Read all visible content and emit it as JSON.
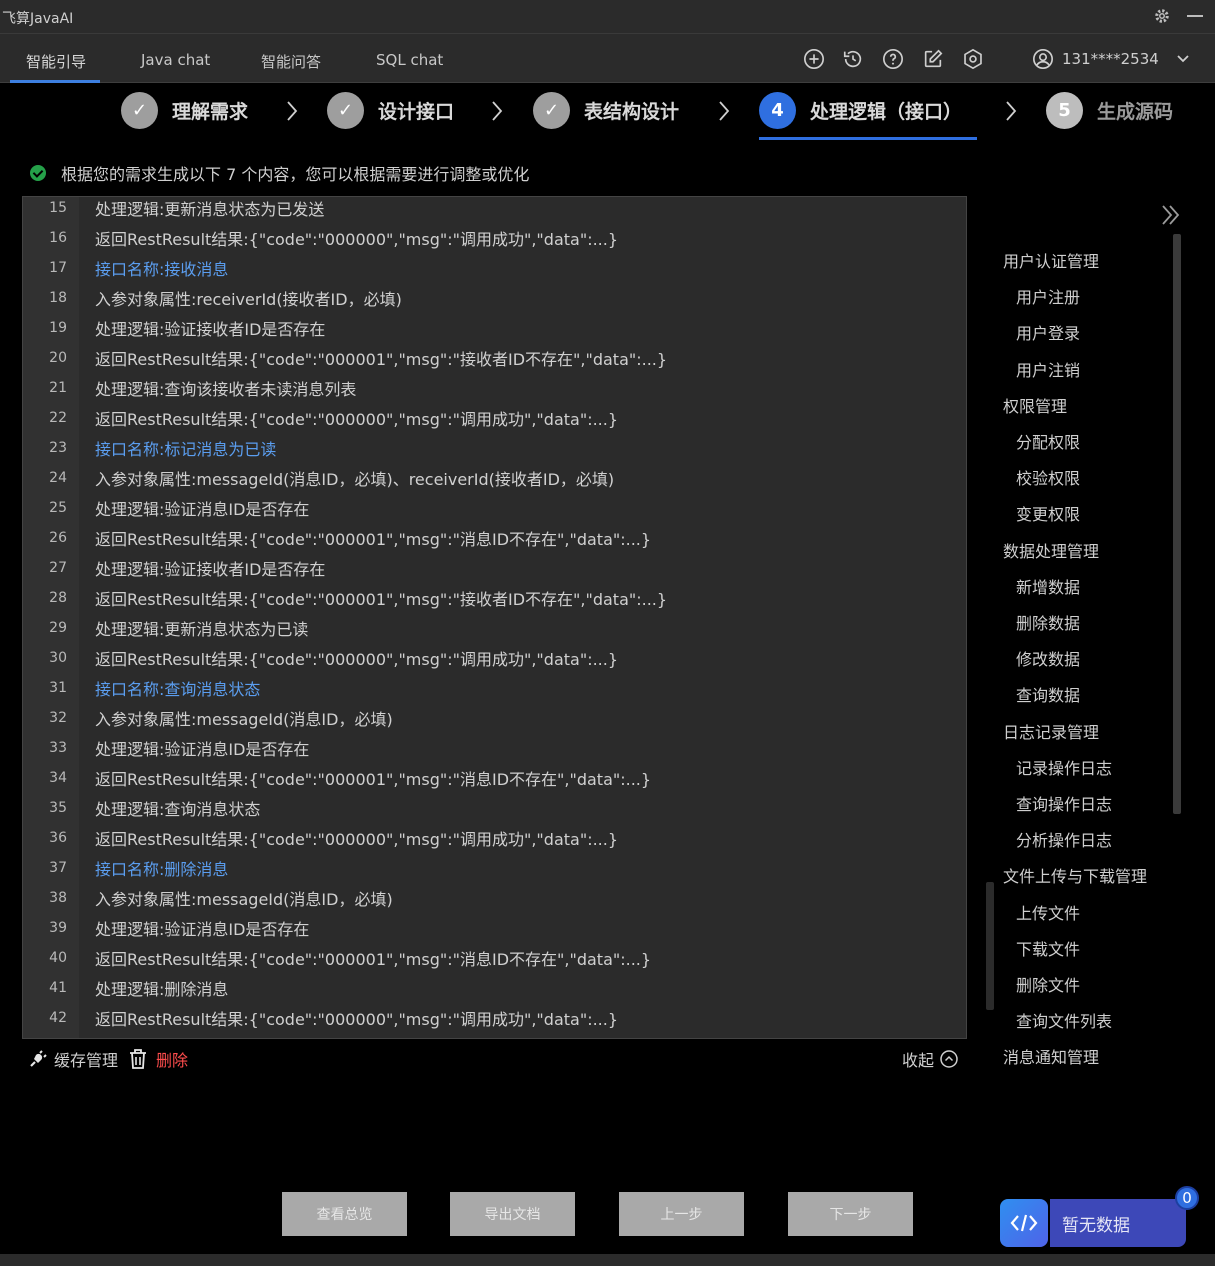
{
  "app": {
    "title": "飞算JavaAI"
  },
  "nav": {
    "tabs": [
      {
        "label": "智能引导"
      },
      {
        "label": "Java chat"
      },
      {
        "label": "智能问答"
      },
      {
        "label": "SQL chat"
      }
    ],
    "user": "131****2534"
  },
  "steps": [
    {
      "num": "✓",
      "label": "理解需求"
    },
    {
      "num": "✓",
      "label": "设计接口"
    },
    {
      "num": "✓",
      "label": "表结构设计"
    },
    {
      "num": "4",
      "label": "处理逻辑（接口）"
    },
    {
      "num": "5",
      "label": "生成源码"
    }
  ],
  "info": "根据您的需求生成以下 7 个内容，您可以根据需要进行调整或优化",
  "editor": {
    "lines": [
      {
        "n": "15",
        "text": "处理逻辑:更新消息状态为已发送",
        "api": false
      },
      {
        "n": "16",
        "text": "返回RestResult结果:{\"code\":\"000000\",\"msg\":\"调用成功\",\"data\":...}",
        "api": false
      },
      {
        "n": "17",
        "text": "接口名称:接收消息",
        "api": true
      },
      {
        "n": "18",
        "text": "入参对象属性:receiverId(接收者ID，必填)",
        "api": false
      },
      {
        "n": "19",
        "text": "处理逻辑:验证接收者ID是否存在",
        "api": false
      },
      {
        "n": "20",
        "text": "返回RestResult结果:{\"code\":\"000001\",\"msg\":\"接收者ID不存在\",\"data\":...}",
        "api": false
      },
      {
        "n": "21",
        "text": "处理逻辑:查询该接收者未读消息列表",
        "api": false
      },
      {
        "n": "22",
        "text": "返回RestResult结果:{\"code\":\"000000\",\"msg\":\"调用成功\",\"data\":...}",
        "api": false
      },
      {
        "n": "23",
        "text": "接口名称:标记消息为已读",
        "api": true
      },
      {
        "n": "24",
        "text": "入参对象属性:messageId(消息ID，必填)、receiverId(接收者ID，必填)",
        "api": false
      },
      {
        "n": "25",
        "text": "处理逻辑:验证消息ID是否存在",
        "api": false
      },
      {
        "n": "26",
        "text": "返回RestResult结果:{\"code\":\"000001\",\"msg\":\"消息ID不存在\",\"data\":...}",
        "api": false
      },
      {
        "n": "27",
        "text": "处理逻辑:验证接收者ID是否存在",
        "api": false
      },
      {
        "n": "28",
        "text": "返回RestResult结果:{\"code\":\"000001\",\"msg\":\"接收者ID不存在\",\"data\":...}",
        "api": false
      },
      {
        "n": "29",
        "text": "处理逻辑:更新消息状态为已读",
        "api": false
      },
      {
        "n": "30",
        "text": "返回RestResult结果:{\"code\":\"000000\",\"msg\":\"调用成功\",\"data\":...}",
        "api": false
      },
      {
        "n": "31",
        "text": "接口名称:查询消息状态",
        "api": true
      },
      {
        "n": "32",
        "text": "入参对象属性:messageId(消息ID，必填)",
        "api": false
      },
      {
        "n": "33",
        "text": "处理逻辑:验证消息ID是否存在",
        "api": false
      },
      {
        "n": "34",
        "text": "返回RestResult结果:{\"code\":\"000001\",\"msg\":\"消息ID不存在\",\"data\":...}",
        "api": false
      },
      {
        "n": "35",
        "text": "处理逻辑:查询消息状态",
        "api": false
      },
      {
        "n": "36",
        "text": "返回RestResult结果:{\"code\":\"000000\",\"msg\":\"调用成功\",\"data\":...}",
        "api": false
      },
      {
        "n": "37",
        "text": "接口名称:删除消息",
        "api": true
      },
      {
        "n": "38",
        "text": "入参对象属性:messageId(消息ID，必填)",
        "api": false
      },
      {
        "n": "39",
        "text": "处理逻辑:验证消息ID是否存在",
        "api": false
      },
      {
        "n": "40",
        "text": "返回RestResult结果:{\"code\":\"000001\",\"msg\":\"消息ID不存在\",\"data\":...}",
        "api": false
      },
      {
        "n": "41",
        "text": "处理逻辑:删除消息",
        "api": false
      },
      {
        "n": "42",
        "text": "返回RestResult结果:{\"code\":\"000000\",\"msg\":\"调用成功\",\"data\":...}",
        "api": false
      }
    ]
  },
  "actions": {
    "cache": "缓存管理",
    "delete": "删除",
    "collapse": "收起"
  },
  "outline": [
    {
      "label": "用户认证管理",
      "level": "group"
    },
    {
      "label": "用户注册",
      "level": "sub"
    },
    {
      "label": "用户登录",
      "level": "sub"
    },
    {
      "label": "用户注销",
      "level": "sub"
    },
    {
      "label": "权限管理",
      "level": "group"
    },
    {
      "label": "分配权限",
      "level": "sub"
    },
    {
      "label": "校验权限",
      "level": "sub"
    },
    {
      "label": "变更权限",
      "level": "sub"
    },
    {
      "label": "数据处理管理",
      "level": "group"
    },
    {
      "label": "新增数据",
      "level": "sub"
    },
    {
      "label": "删除数据",
      "level": "sub"
    },
    {
      "label": "修改数据",
      "level": "sub"
    },
    {
      "label": "查询数据",
      "level": "sub"
    },
    {
      "label": "日志记录管理",
      "level": "group"
    },
    {
      "label": "记录操作日志",
      "level": "sub"
    },
    {
      "label": "查询操作日志",
      "level": "sub"
    },
    {
      "label": "分析操作日志",
      "level": "sub"
    },
    {
      "label": "文件上传与下载管理",
      "level": "group"
    },
    {
      "label": "上传文件",
      "level": "sub"
    },
    {
      "label": "下载文件",
      "level": "sub"
    },
    {
      "label": "删除文件",
      "level": "sub"
    },
    {
      "label": "查询文件列表",
      "level": "sub"
    },
    {
      "label": "消息通知管理",
      "level": "group"
    }
  ],
  "footer": {
    "overview": "查看总览",
    "export": "导出文档",
    "prev": "上一步",
    "next": "下一步"
  },
  "widget": {
    "label": "暂无数据",
    "badge": "0"
  },
  "colors": {
    "accent": "#2f6fe0",
    "api_text": "#5b9ef0",
    "delete": "#ff4d4d",
    "success": "#25a049"
  }
}
